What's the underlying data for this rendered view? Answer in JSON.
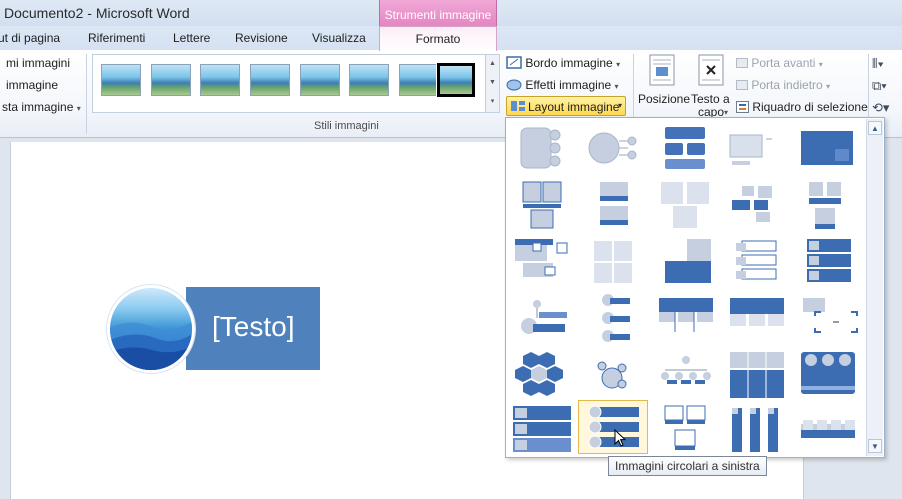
{
  "window": {
    "title": "Documento2  -  Microsoft Word"
  },
  "contextual": {
    "header": "Strumenti immagine",
    "tab": "Formato",
    "color": "#e486c3"
  },
  "tabs": [
    "ut di pagina",
    "Riferimenti",
    "Lettere",
    "Revisione",
    "Visualizza"
  ],
  "ribbon": {
    "left_group": {
      "items": [
        "mi immagini",
        "immagine",
        "sta immagine"
      ]
    },
    "styles_group": {
      "label": "Stili immagini",
      "thumbnail_count": 8,
      "selected_index": 7
    },
    "picture_commands": {
      "border": "Bordo immagine",
      "effects": "Effetti immagine",
      "layout": "Layout immagine"
    },
    "arrange_group": {
      "position": "Posizione",
      "wrap_line1": "Testo a",
      "wrap_line2": "capo",
      "bring_forward": "Porta avanti",
      "send_backward": "Porta indietro",
      "selection_pane": "Riquadro di selezione"
    }
  },
  "document": {
    "smartart_placeholder": "[Testo]",
    "accent": "#4f81bd"
  },
  "layout_gallery": {
    "rows": 6,
    "columns": 5,
    "hovered": {
      "row": 6,
      "column": 2
    },
    "tooltip": "Immagini circolari a sinistra"
  }
}
